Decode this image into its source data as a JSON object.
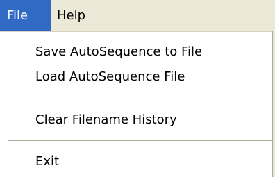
{
  "menubar": {
    "file_label": "File",
    "help_label": "Help"
  },
  "file_menu": {
    "items": [
      {
        "label": "Save AutoSequence to File"
      },
      {
        "label": "Load AutoSequence File"
      },
      {
        "label": "Clear Filename History"
      },
      {
        "label": "Exit"
      }
    ]
  },
  "colors": {
    "menubar_bg": "#ece9d8",
    "selected_bg": "#316ac5",
    "selected_text": "#ffffff",
    "separator": "#aca899"
  }
}
